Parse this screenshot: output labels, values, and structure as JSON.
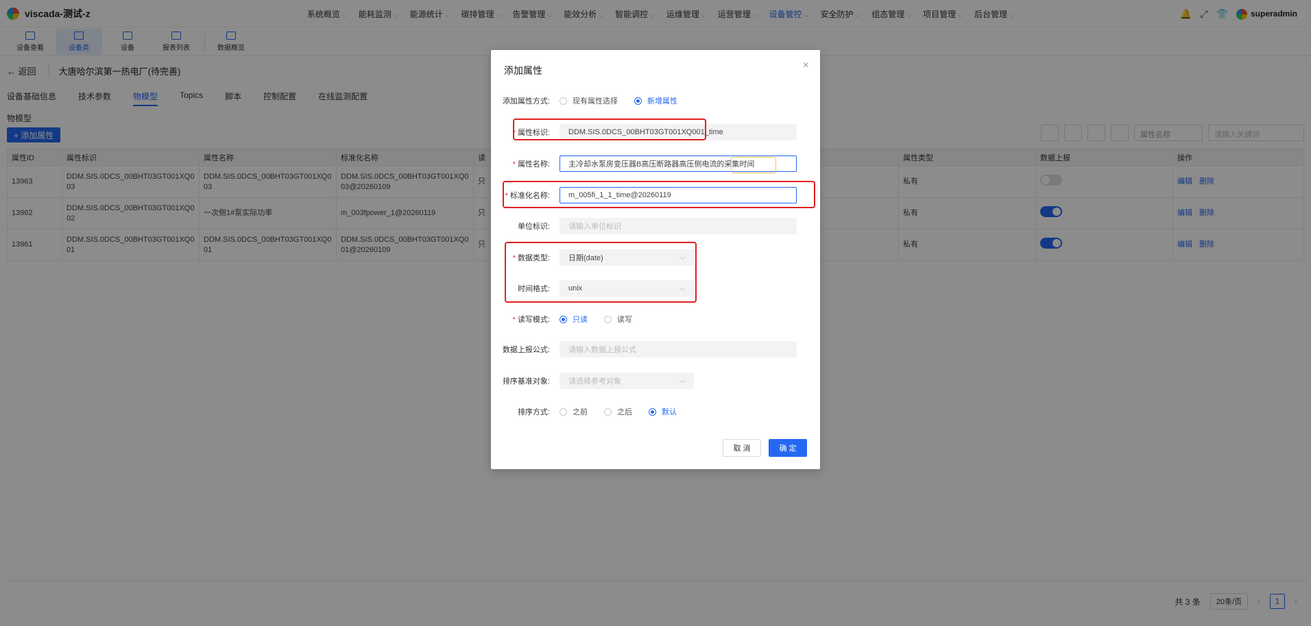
{
  "app": {
    "title": "viscada-测试-z",
    "user": "superadmin"
  },
  "topnav": [
    {
      "label": "系统概览",
      "active": false
    },
    {
      "label": "能耗监测",
      "active": false
    },
    {
      "label": "能源统计",
      "active": false
    },
    {
      "label": "碳排管理",
      "active": false
    },
    {
      "label": "告警管理",
      "active": false
    },
    {
      "label": "能效分析",
      "active": false
    },
    {
      "label": "智能调控",
      "active": false
    },
    {
      "label": "运维管理",
      "active": false
    },
    {
      "label": "运营管理",
      "active": false
    },
    {
      "label": "设备管控",
      "active": true
    },
    {
      "label": "安全防护",
      "active": false
    },
    {
      "label": "组态管理",
      "active": false
    },
    {
      "label": "项目管理",
      "active": false
    },
    {
      "label": "后台管理",
      "active": false
    }
  ],
  "subbar": [
    {
      "label": "设备查看",
      "active": false
    },
    {
      "label": "设备类",
      "active": true
    },
    {
      "label": "设备",
      "active": false
    },
    {
      "label": "报表列表",
      "active": false
    },
    {
      "label": "数据概览",
      "active": false
    }
  ],
  "page": {
    "back": "← 返回",
    "title": "大唐哈尔滨第一热电厂(待完善)",
    "tabs": [
      {
        "label": "设备基础信息",
        "active": false
      },
      {
        "label": "技术参数",
        "active": false
      },
      {
        "label": "物模型",
        "active": true
      },
      {
        "label": "Topics",
        "active": false
      },
      {
        "label": "脚本",
        "active": false
      },
      {
        "label": "控制配置",
        "active": false
      },
      {
        "label": "在线监测配置",
        "active": false
      }
    ],
    "section": "物模型",
    "add_button": "+ 添加属性",
    "filter_select": "属性名称",
    "search_placeholder": "请输入关键词"
  },
  "table": {
    "columns": [
      "属性ID",
      "属性标识",
      "属性名称",
      "标准化名称",
      "读",
      "属性类型",
      "数据上报",
      "操作"
    ],
    "rows": [
      {
        "id": "13963",
        "key": "DDM.SIS.0DCS_00BHT03GT001XQ003",
        "name": "DDM.SIS.0DCS_00BHT03GT001XQ003",
        "std": "DDM.SIS.0DCS_00BHT03GT001XQ003@20260109",
        "rw": "只",
        "type": "私有",
        "report": false
      },
      {
        "id": "13962",
        "key": "DDM.SIS.0DCS_00BHT03GT001XQ002",
        "name": "一次侧1#泵实际功率",
        "std": "m_003fpower_1@20260119",
        "rw": "只",
        "type": "私有",
        "report": true
      },
      {
        "id": "13961",
        "key": "DDM.SIS.0DCS_00BHT03GT001XQ001",
        "name": "DDM.SIS.0DCS_00BHT03GT001XQ001",
        "std": "DDM.SIS.0DCS_00BHT03GT001XQ001@20260109",
        "rw": "只",
        "type": "私有",
        "report": true
      }
    ],
    "op_edit": "编辑",
    "op_delete": "删除"
  },
  "pager": {
    "total": "共 3 条",
    "size": "20条/页",
    "page": "1"
  },
  "modal": {
    "title": "添加属性",
    "close": "×",
    "mode_label": "添加属性方式:",
    "mode_options": [
      {
        "label": "现有属性选择",
        "checked": false
      },
      {
        "label": "新增属性",
        "checked": true
      }
    ],
    "key_label": "属性标识:",
    "key_value": "DDM.SIS.0DCS_00BHT03GT001XQ001_time",
    "name_label": "属性名称:",
    "name_value": "主冷却水泵房变压器B高压断路器高压侧电流的采集时间",
    "std_label": "标准化名称:",
    "std_value": "m_005fi_1_1_time@20260119",
    "unit_label": "单位标识:",
    "unit_placeholder": "请输入单位标识",
    "dtype_label": "数据类型:",
    "dtype_value": "日期(date)",
    "tfmt_label": "时间格式:",
    "tfmt_value": "unix",
    "rw_label": "读写模式:",
    "rw_options": [
      {
        "label": "只读",
        "checked": true
      },
      {
        "label": "读写",
        "checked": false
      }
    ],
    "formula_label": "数据上报公式:",
    "formula_placeholder": "请输入数据上报公式",
    "ref_label": "排序基准对象:",
    "ref_placeholder": "请选择参考对象",
    "order_label": "排序方式:",
    "order_options": [
      {
        "label": "之前",
        "checked": false
      },
      {
        "label": "之后",
        "checked": false
      },
      {
        "label": "默认",
        "checked": true
      }
    ],
    "cancel": "取 消",
    "ok": "确 定"
  }
}
